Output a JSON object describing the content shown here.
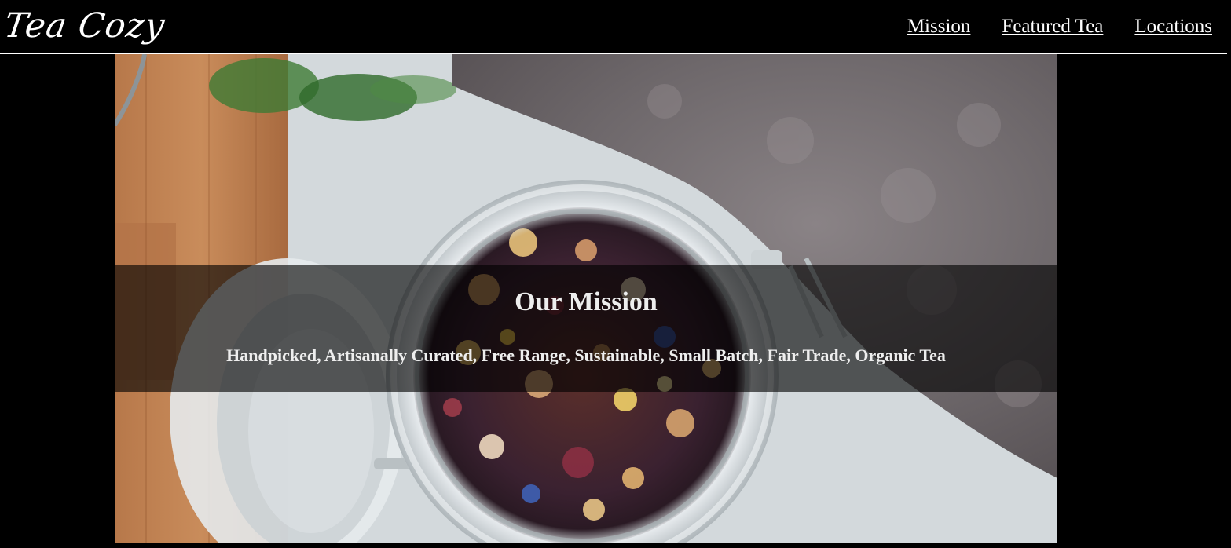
{
  "header": {
    "logo_text": "Tea Cozy",
    "nav": [
      {
        "label": "Mission"
      },
      {
        "label": "Featured Tea"
      },
      {
        "label": "Locations"
      }
    ]
  },
  "hero": {
    "image_subject": "tea-jar-photo",
    "title": "Our Mission",
    "subtitle": "Handpicked, Artisanally Curated, Free Range, Sustainable, Small Batch, Fair Trade, Organic Tea"
  },
  "colors": {
    "background": "#000000",
    "header_border": "#ffffff",
    "text": "#eeeeee",
    "overlay": "rgba(0,0,0,0.62)"
  }
}
